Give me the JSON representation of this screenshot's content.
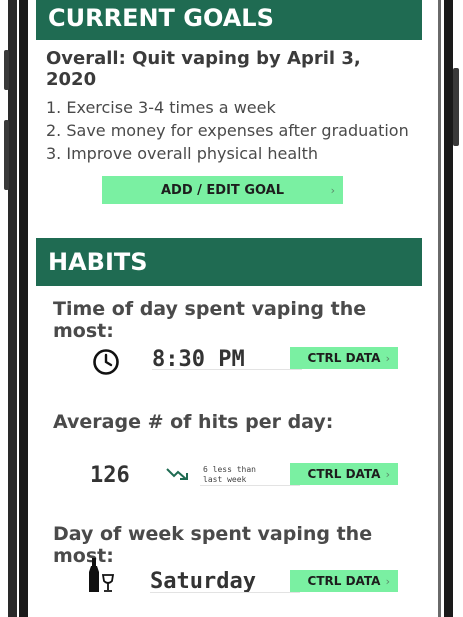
{
  "goals": {
    "header": "CURRENT GOALS",
    "overall": "Overall: Quit vaping by April 3, 2020",
    "items": [
      "1. Exercise 3-4 times a week",
      "2. Save money for expenses after graduation",
      "3. Improve overall physical health"
    ],
    "add_button": "ADD / EDIT GOAL"
  },
  "habits": {
    "header": "HABITS",
    "time_title": "Time of day spent vaping the most:",
    "time_value": "8:30 PM",
    "hits_title": "Average # of hits per day:",
    "hits_value": "126",
    "hits_note_line1": "6 less than",
    "hits_note_line2": "last week",
    "day_title": "Day of week spent vaping the most:",
    "day_value": "Saturday",
    "ctrl_label": "CTRL DATA",
    "chevron": "›"
  },
  "colors": {
    "header_green": "#1f6b52",
    "button_green": "#7af0a2"
  },
  "icons": [
    "clock-icon",
    "trend-down-icon",
    "bottle-glass-icon",
    "chevron-right-icon"
  ]
}
